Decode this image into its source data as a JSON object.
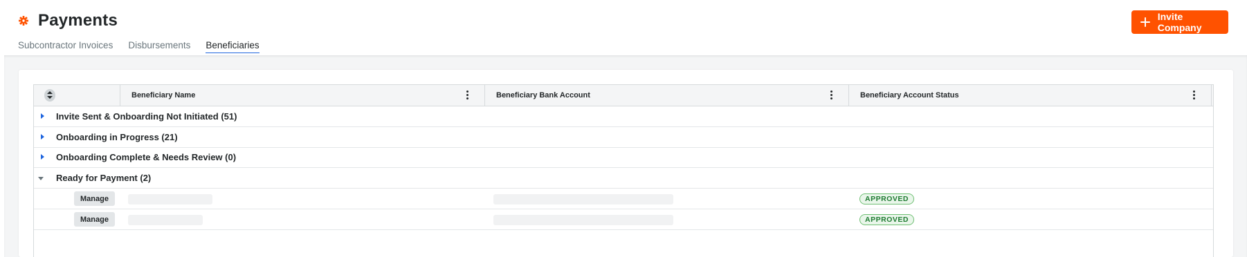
{
  "page": {
    "title": "Payments",
    "app_icon": "gear-icon",
    "accent_color": "#ff5200",
    "link_color": "#2066df"
  },
  "actions": {
    "invite_label": "Invite Company",
    "invite_icon": "plus-icon"
  },
  "tabs": [
    {
      "label": "Subcontractor Invoices",
      "active": false
    },
    {
      "label": "Disbursements",
      "active": false
    },
    {
      "label": "Beneficiaries",
      "active": true
    }
  ],
  "grid": {
    "columns": [
      {
        "label": "Beneficiary Name"
      },
      {
        "label": "Beneficiary Bank Account"
      },
      {
        "label": "Beneficiary Account Status"
      }
    ],
    "groups": [
      {
        "label": "Invite Sent & Onboarding Not Initiated (51)",
        "expanded": false
      },
      {
        "label": "Onboarding in Progress (21)",
        "expanded": false
      },
      {
        "label": "Onboarding Complete & Needs Review (0)",
        "expanded": false
      },
      {
        "label": "Ready for Payment (2)",
        "expanded": true
      }
    ],
    "rows": [
      {
        "action_label": "Manage",
        "status": "APPROVED"
      },
      {
        "action_label": "Manage",
        "status": "APPROVED"
      }
    ],
    "status_color": "#1e7b31"
  }
}
